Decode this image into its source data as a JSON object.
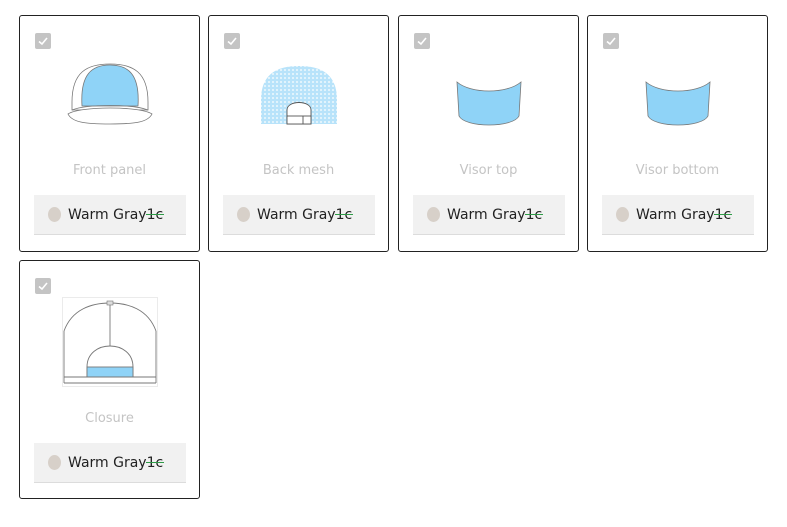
{
  "colors": {
    "selected_fill": "#8fd3f7",
    "swatch": "#d7d0c9",
    "checkbox": "#c4c4c4",
    "label": "#c4c4c4"
  },
  "parts": [
    {
      "label": "Front panel",
      "color_main": "Warm Gray ",
      "color_code": "1c",
      "checked": true,
      "icon": "cap-front-panel-icon"
    },
    {
      "label": "Back mesh",
      "color_main": "Warm Gray ",
      "color_code": "1c",
      "checked": true,
      "icon": "cap-back-mesh-icon"
    },
    {
      "label": "Visor top",
      "color_main": "Warm Gray ",
      "color_code": "1c",
      "checked": true,
      "icon": "visor-top-icon"
    },
    {
      "label": "Visor bottom",
      "color_main": "Warm Gray ",
      "color_code": "1c",
      "checked": true,
      "icon": "visor-bottom-icon"
    },
    {
      "label": "Closure",
      "color_main": "Warm Gray ",
      "color_code": "1c",
      "checked": true,
      "icon": "cap-closure-icon"
    }
  ]
}
